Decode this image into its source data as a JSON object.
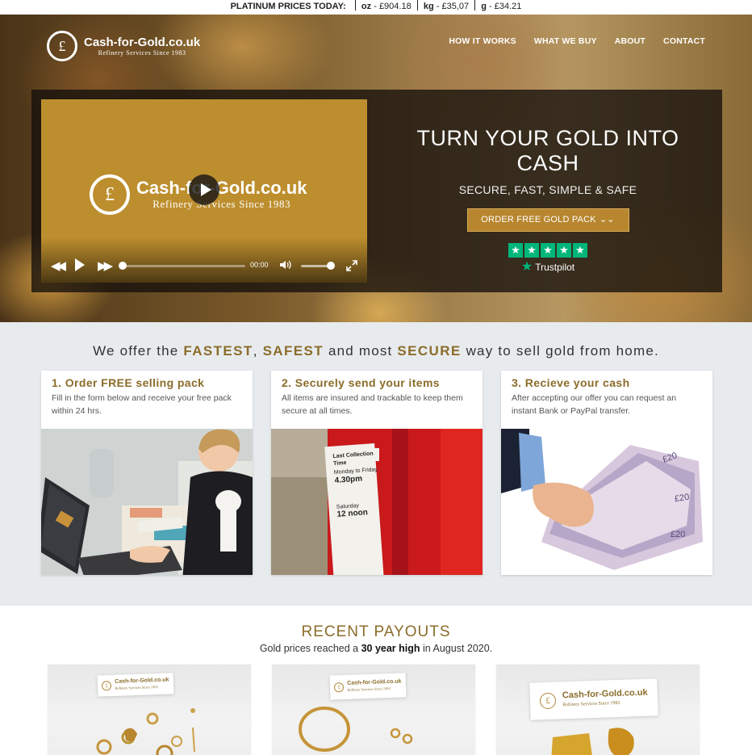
{
  "ticker": {
    "label": "PLATINUM PRICES TODAY:",
    "items": [
      {
        "unit": "oz",
        "price": "£904.18"
      },
      {
        "unit": "kg",
        "price": "£35,07"
      },
      {
        "unit": "g",
        "price": "£34.21"
      }
    ]
  },
  "header": {
    "logo_name": "Cash-for-Gold.co.uk",
    "logo_tagline": "Refinery Services Since 1983",
    "coin_symbol": "£",
    "nav": [
      "HOW IT WORKS",
      "WHAT WE BUY",
      "ABOUT",
      "CONTACT"
    ]
  },
  "hero": {
    "video": {
      "logo_name": "Cash-for-Gold.co.uk",
      "logo_tagline": "Refinery Services Since 1983",
      "time": "00:00",
      "progress": 0,
      "volume": 0.8
    },
    "title": "TURN YOUR GOLD INTO CASH",
    "subtitle": "SECURE, FAST, SIMPLE & SAFE",
    "cta": "ORDER FREE GOLD PACK",
    "trustpilot": {
      "stars": 5,
      "label": "Trustpilot"
    }
  },
  "steps": {
    "headline": {
      "pre": "We offer the ",
      "w1": "FASTEST",
      "c1": ", ",
      "w2": "SAFEST",
      "c2": " and most ",
      "w3": "SECURE",
      "post": " way to sell gold from home."
    },
    "cards": [
      {
        "title": "1. Order FREE selling pack",
        "desc": "Fill in the form below and receive your free pack within 24 hrs."
      },
      {
        "title": "2. Securely send your items",
        "desc": "All items are insured and trackable to keep them secure at all times."
      },
      {
        "title": "3. Recieve your cash",
        "desc": "After accepting our offer you can request an instant Bank or PayPal transfer."
      }
    ]
  },
  "postbox": {
    "line1": "Last Collection Time",
    "line2": "Monday to Friday",
    "line3": "4.30pm",
    "line4": "Saturday",
    "line5": "12 noon"
  },
  "banknote_label": "£20",
  "payouts": {
    "title": "RECENT PAYOUTS",
    "sub_pre": "Gold prices reached a ",
    "sub_bold": "30 year high",
    "sub_post": " in August 2020.",
    "card_brand": "Cash-for-Gold.co.uk",
    "card_tagline": "Refinery Services Since 1983"
  },
  "colors": {
    "gold": "#8b6c2a",
    "cta": "#b8862e",
    "trustpilot": "#00b67a"
  }
}
